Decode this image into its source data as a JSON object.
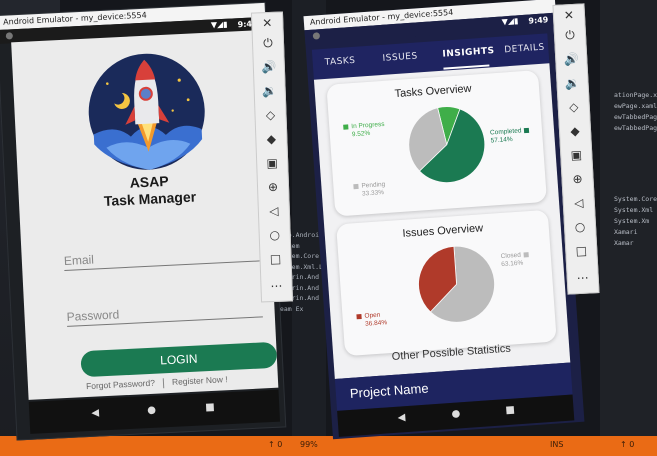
{
  "ide": {
    "left_refs": [
      "Mono.Android",
      "System",
      "System.Core",
      "System.Xml.Li",
      "Xamarin.And",
      "Xamarin.And",
      "Xamarin.And",
      "Team Ex"
    ],
    "right_refs": [
      "ationPage.xa",
      "ewPage.xaml",
      "ewTabbedPag",
      "ewTabbedPag",
      "System.Core",
      "System.Xml",
      "System.Xm",
      "Xamari",
      "Xamar"
    ],
    "status_left": "↑ 0",
    "status_left2": "99%",
    "status_right": "INS",
    "status_right2": "↑ 0"
  },
  "left_emulator": {
    "title": "Android Emulator - my_device:5554",
    "time": "9:49",
    "app_name_line1": "ASAP",
    "app_name_line2": "Task Manager",
    "email_placeholder": "Email",
    "password_placeholder": "Password",
    "login_label": "LOGIN",
    "forgot_label": "Forgot Password?",
    "register_label": "Register Now !",
    "nav_back": "◀",
    "nav_home": "●",
    "nav_recent": "■"
  },
  "right_emulator": {
    "title": "Android Emulator - my_device:5554",
    "time": "9:49",
    "tabs": [
      "TASKS",
      "ISSUES",
      "INSIGHTS",
      "DETAILS"
    ],
    "active_tab": "INSIGHTS",
    "tasks_card": {
      "title": "Tasks Overview",
      "legend": [
        {
          "label": "In Progress",
          "value": "9.52%",
          "color": "#3fae49"
        },
        {
          "label": "Completed",
          "value": "57.14%",
          "color": "#1b7a52"
        },
        {
          "label": "Pending",
          "value": "33.33%",
          "color": "#bcbcbc"
        }
      ]
    },
    "issues_card": {
      "title": "Issues Overview",
      "legend": [
        {
          "label": "Closed",
          "value": "63.16%",
          "color": "#bcbcbc"
        },
        {
          "label": "Open",
          "value": "36.84%",
          "color": "#b03a2a"
        }
      ]
    },
    "other_stats": "Other Possible Statistics",
    "project_name": "Project Name",
    "nav_back": "◀",
    "nav_home": "●",
    "nav_recent": "■"
  },
  "chart_data": [
    {
      "type": "pie",
      "categories": [
        "In Progress",
        "Completed",
        "Pending"
      ],
      "values": [
        9.52,
        57.14,
        33.33
      ],
      "title": "Tasks Overview"
    },
    {
      "type": "pie",
      "categories": [
        "Closed",
        "Open"
      ],
      "values": [
        63.16,
        36.84
      ],
      "title": "Issues Overview"
    }
  ]
}
